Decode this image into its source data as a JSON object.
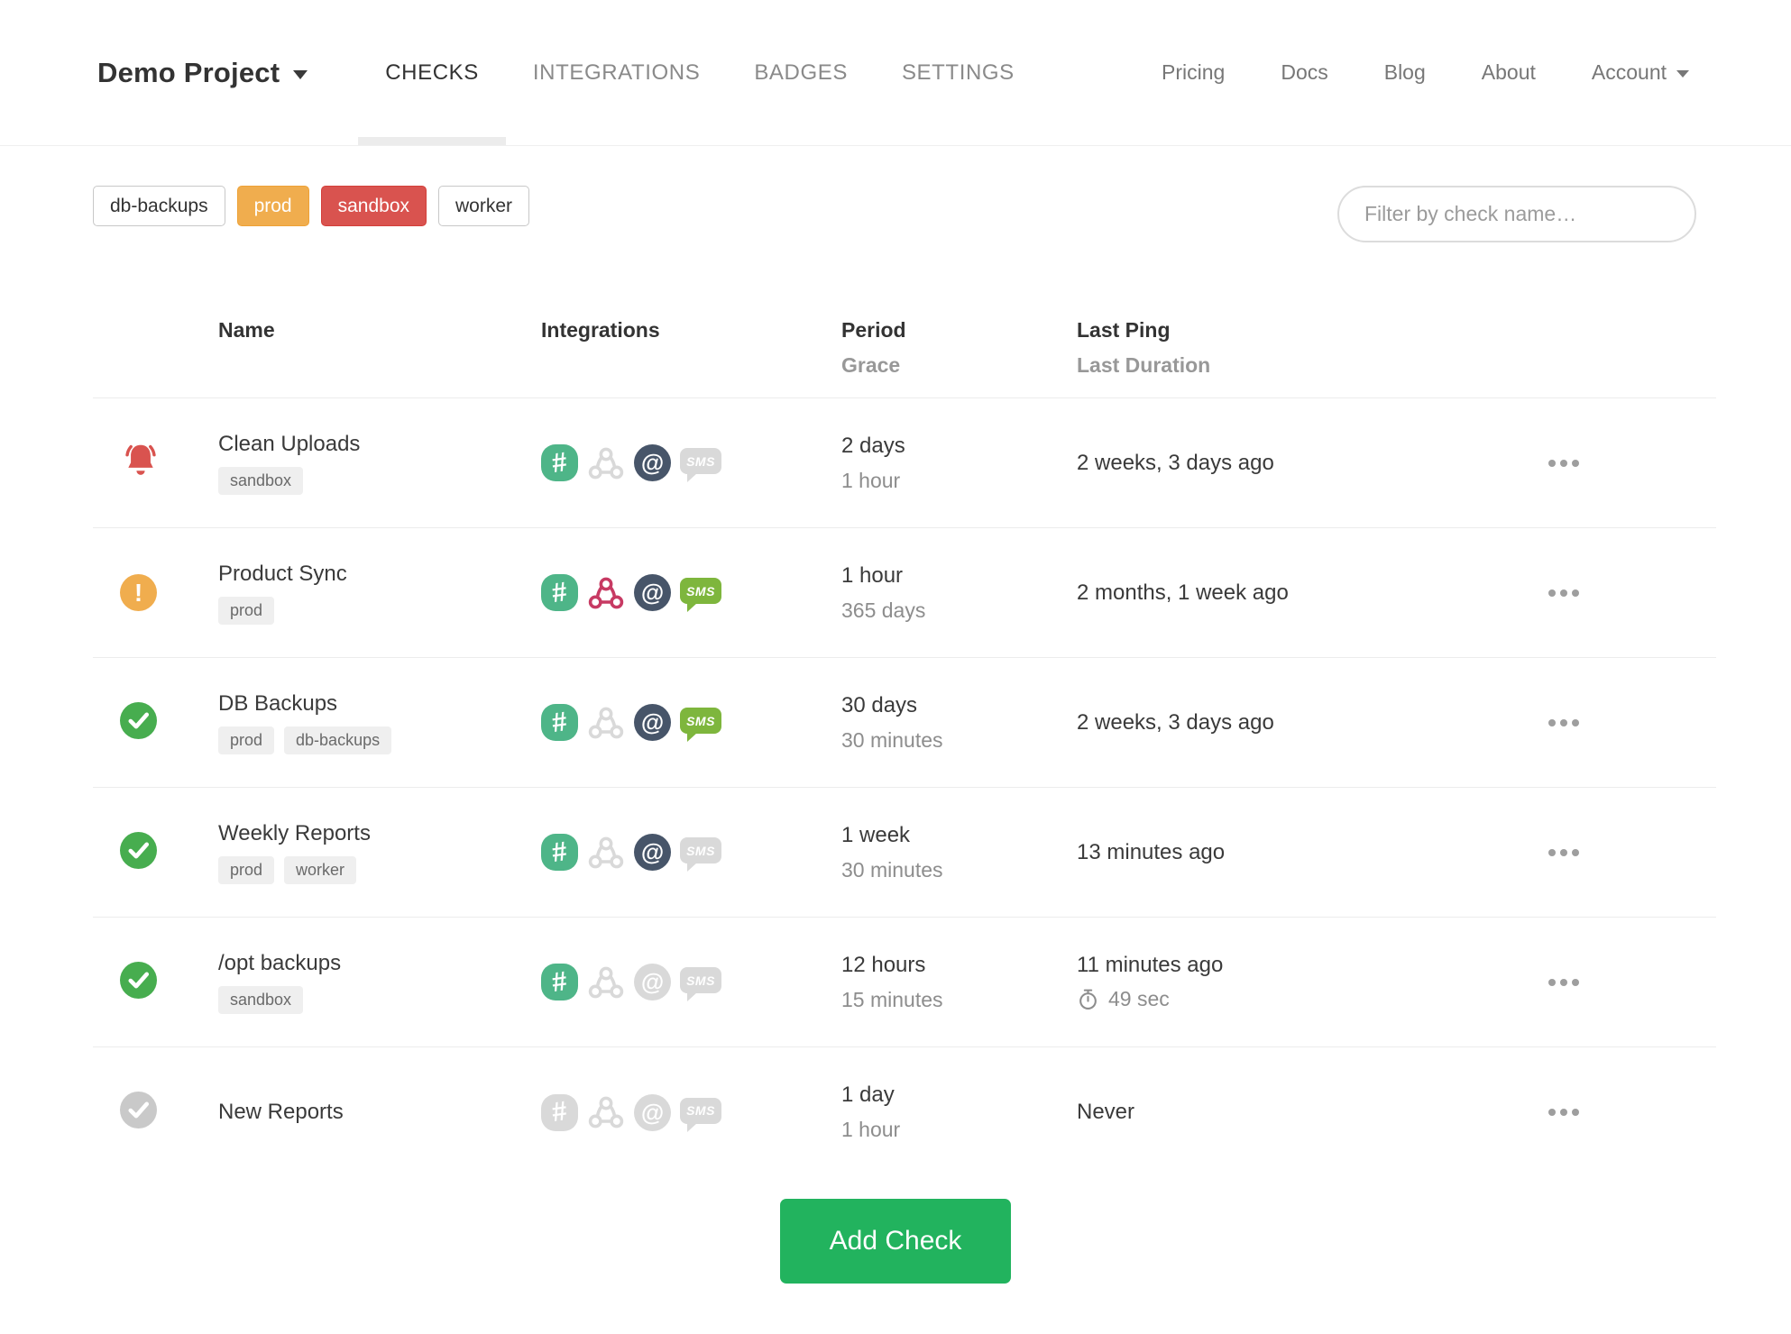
{
  "nav": {
    "project_label": "Demo Project",
    "tabs": [
      {
        "label": "CHECKS",
        "active": true
      },
      {
        "label": "INTEGRATIONS",
        "active": false
      },
      {
        "label": "BADGES",
        "active": false
      },
      {
        "label": "SETTINGS",
        "active": false
      }
    ],
    "links": [
      {
        "label": "Pricing"
      },
      {
        "label": "Docs"
      },
      {
        "label": "Blog"
      },
      {
        "label": "About"
      }
    ],
    "account_label": "Account"
  },
  "filters": {
    "tag_buttons": [
      {
        "label": "db-backups",
        "variant": "default"
      },
      {
        "label": "prod",
        "variant": "warning"
      },
      {
        "label": "sandbox",
        "variant": "danger"
      },
      {
        "label": "worker",
        "variant": "default"
      }
    ],
    "search_placeholder": "Filter by check name…"
  },
  "table": {
    "headers": {
      "name": "Name",
      "integrations": "Integrations",
      "period": "Period",
      "grace": "Grace",
      "last_ping": "Last Ping",
      "last_duration": "Last Duration"
    },
    "rows": [
      {
        "status": "alert",
        "name": "Clean Uploads",
        "tags": [
          "sandbox"
        ],
        "integrations": {
          "slack": true,
          "webhook": false,
          "email": true,
          "sms": false
        },
        "period": "2 days",
        "grace": "1 hour",
        "last_ping": "2 weeks, 3 days ago",
        "last_duration": ""
      },
      {
        "status": "warning",
        "name": "Product Sync",
        "tags": [
          "prod"
        ],
        "integrations": {
          "slack": true,
          "webhook": true,
          "email": true,
          "sms": true
        },
        "period": "1 hour",
        "grace": "365 days",
        "last_ping": "2 months, 1 week ago",
        "last_duration": ""
      },
      {
        "status": "ok",
        "name": "DB Backups",
        "tags": [
          "prod",
          "db-backups"
        ],
        "integrations": {
          "slack": true,
          "webhook": false,
          "email": true,
          "sms": true
        },
        "period": "30 days",
        "grace": "30 minutes",
        "last_ping": "2 weeks, 3 days ago",
        "last_duration": ""
      },
      {
        "status": "ok",
        "name": "Weekly Reports",
        "tags": [
          "prod",
          "worker"
        ],
        "integrations": {
          "slack": true,
          "webhook": false,
          "email": true,
          "sms": false
        },
        "period": "1 week",
        "grace": "30 minutes",
        "last_ping": "13 minutes ago",
        "last_duration": ""
      },
      {
        "status": "ok",
        "name": "/opt backups",
        "tags": [
          "sandbox"
        ],
        "integrations": {
          "slack": true,
          "webhook": false,
          "email": false,
          "sms": false
        },
        "period": "12 hours",
        "grace": "15 minutes",
        "last_ping": "11 minutes ago",
        "last_duration": "49 sec"
      },
      {
        "status": "new",
        "name": "New Reports",
        "tags": [],
        "integrations": {
          "slack": false,
          "webhook": false,
          "email": false,
          "sms": false
        },
        "period": "1 day",
        "grace": "1 hour",
        "last_ping": "Never",
        "last_duration": ""
      }
    ]
  },
  "glyphs": {
    "slack": "#",
    "email": "@",
    "sms": "SMS"
  },
  "add_check_label": "Add Check",
  "colors": {
    "slack_green": "#4eb588",
    "webhook_crimson": "#c73a63",
    "email_slate": "#475569",
    "sms_green": "#7eb63d",
    "inactive_gray": "#d9d9d9",
    "status_alert": "#d9534f",
    "status_warning": "#f0ad4e",
    "status_ok": "#47ad4f",
    "status_new": "#c9c9c9",
    "add_button_green": "#22b35e",
    "tag_prod": "#f0ad4e",
    "tag_sandbox": "#d9534f"
  }
}
